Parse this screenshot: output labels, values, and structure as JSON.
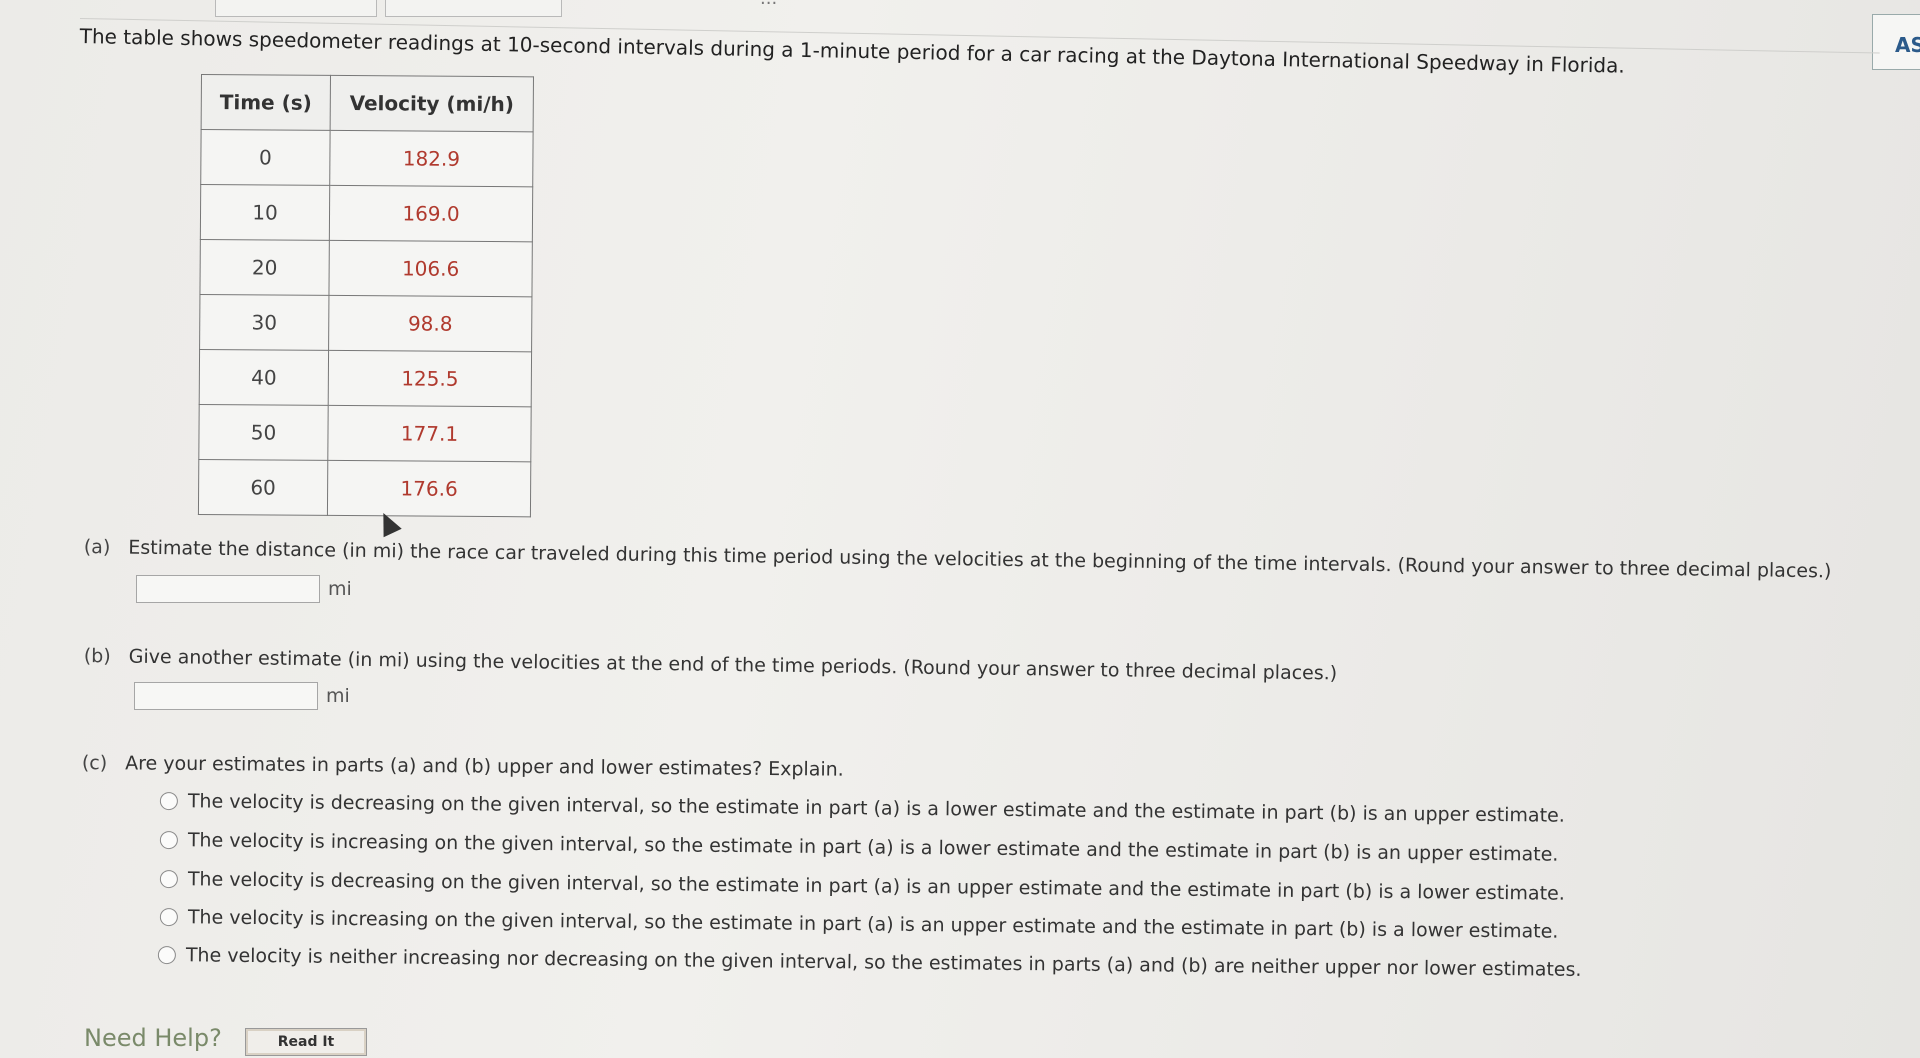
{
  "top": {
    "partial_text": "...",
    "as_button": "AS"
  },
  "intro": "The table shows speedometer readings at 10-second intervals during a 1-minute period for a car racing at the Daytona International Speedway in Florida.",
  "table": {
    "headers": [
      "Time (s)",
      "Velocity (mi/h)"
    ],
    "rows": [
      [
        "0",
        "182.9"
      ],
      [
        "10",
        "169.0"
      ],
      [
        "20",
        "106.6"
      ],
      [
        "30",
        "98.8"
      ],
      [
        "40",
        "125.5"
      ],
      [
        "50",
        "177.1"
      ],
      [
        "60",
        "176.6"
      ]
    ]
  },
  "part_a": {
    "tag": "(a)",
    "question": "Estimate the distance (in mi) the race car traveled during this time period using the velocities at the beginning of the time intervals. (Round your answer to three decimal places.)",
    "unit": "mi",
    "value": ""
  },
  "part_b": {
    "tag": "(b)",
    "question": "Give another estimate (in mi) using the velocities at the end of the time periods. (Round your answer to three decimal places.)",
    "unit": "mi",
    "value": ""
  },
  "part_c": {
    "tag": "(c)",
    "question": "Are your estimates in parts (a) and (b) upper and lower estimates? Explain.",
    "options": [
      "The velocity is decreasing on the given interval, so the estimate in part (a) is a lower estimate and the estimate in part (b) is an upper estimate.",
      "The velocity is increasing on the given interval, so the estimate in part (a) is a lower estimate and the estimate in part (b) is an upper estimate.",
      "The velocity is decreasing on the given interval, so the estimate in part (a) is an upper estimate and the estimate in part (b) is a lower estimate.",
      "The velocity is increasing on the given interval, so the estimate in part (a) is an upper estimate and the estimate in part (b) is a lower estimate.",
      "The velocity is neither increasing nor decreasing on the given interval, so the estimates in parts (a) and (b) are neither upper nor lower estimates."
    ]
  },
  "help": {
    "label": "Need Help?",
    "read_it": "Read It"
  }
}
